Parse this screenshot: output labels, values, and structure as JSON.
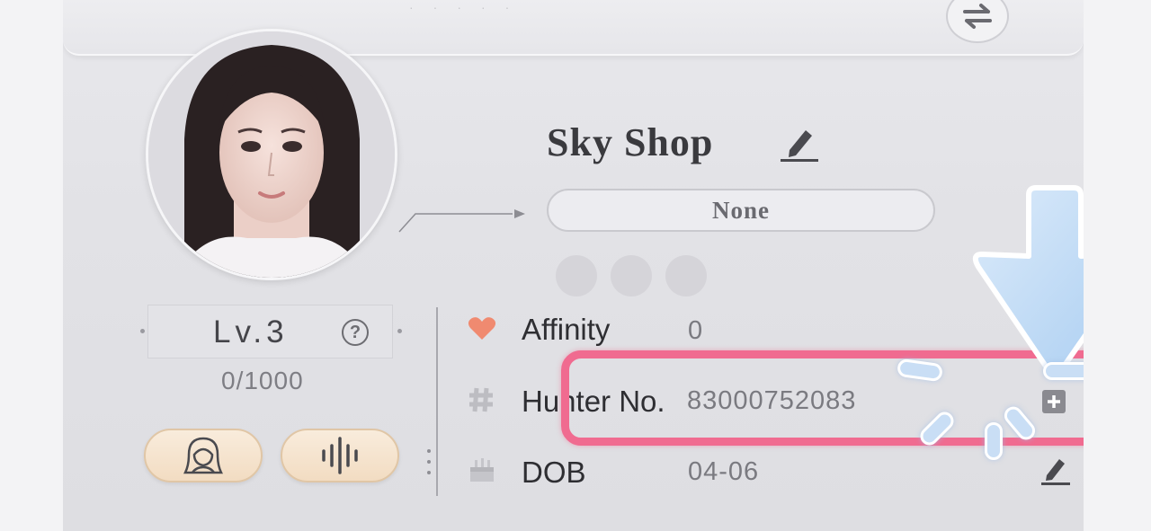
{
  "profile": {
    "name": "Sky Shop",
    "title": "None",
    "level": "Lv.3",
    "exp": "0/1000",
    "help": "?"
  },
  "info": [
    {
      "icon": "heart-icon",
      "label": "Affinity",
      "value": "0"
    },
    {
      "icon": "hash-icon",
      "label": "Hunter No.",
      "value": "83000752083"
    },
    {
      "icon": "cake-icon",
      "label": "DOB",
      "value": "04-06"
    }
  ],
  "colors": {
    "highlight": "#f06b90",
    "heart": "#f08a70",
    "button": "#f2dcc2",
    "arrow": "#c5dcf4"
  }
}
